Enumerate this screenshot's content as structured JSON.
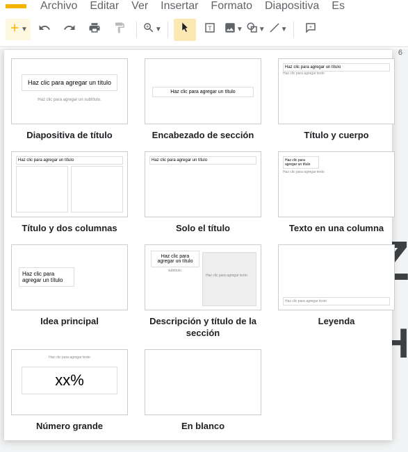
{
  "menu": {
    "file": "Archivo",
    "edit": "Editar",
    "view": "Ver",
    "insert": "Insertar",
    "format": "Formato",
    "slide": "Diapositiva",
    "more": "Es"
  },
  "ruler": {
    "tick": "6"
  },
  "thumb_text": {
    "click_title": "Haz clic para agregar un título",
    "click_subtitle": "Haz clic para agregar un subtítulo.",
    "click_text": "Haz clic para agregar texto",
    "subtitle_short": "subtítulo.",
    "big_number": "xx%"
  },
  "layouts": {
    "title_slide": "Diapositiva de título",
    "section_header": "Encabezado de sección",
    "title_body": "Título y cuerpo",
    "two_columns": "Título y dos columnas",
    "title_only": "Solo el título",
    "one_column": "Texto en una columna",
    "main_idea": "Idea principal",
    "section_desc": "Descripción y título de la sección",
    "caption": "Leyenda",
    "big_number": "Número grande",
    "blank": "En blanco"
  },
  "canvas": {
    "letter1": "Z",
    "letter2": "H"
  }
}
